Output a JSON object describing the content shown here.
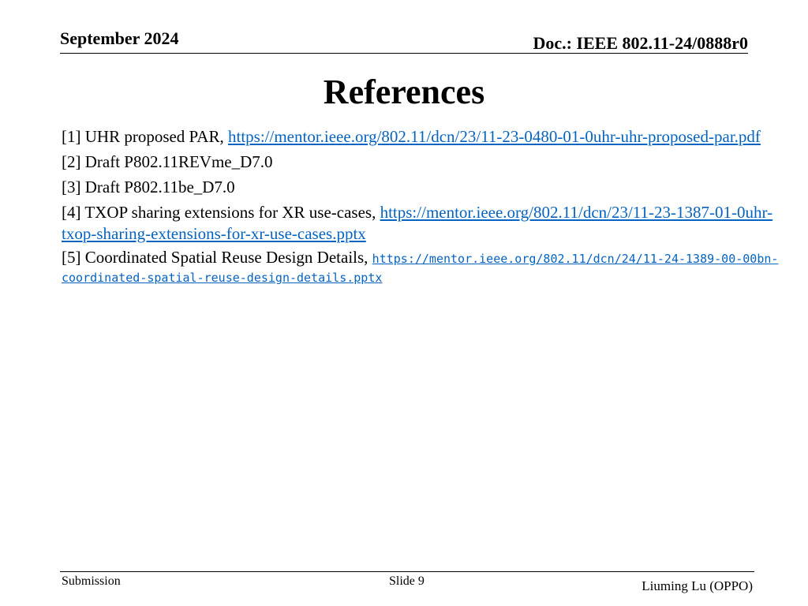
{
  "header": {
    "date": "September 2024",
    "doc_id": "Doc.: IEEE 802.11-24/0888r0"
  },
  "title": "References",
  "references": [
    {
      "text": "[1] UHR proposed PAR, ",
      "link": "https://mentor.ieee.org/802.11/dcn/23/11-23-0480-01-0uhr-uhr-proposed-par.pdf"
    },
    {
      "text": "[2] Draft P802.11REVme_D7.0"
    },
    {
      "text": "[3] Draft P802.11be_D7.0"
    },
    {
      "text": "[4] TXOP sharing extensions for XR use-cases, ",
      "link": "https://mentor.ieee.org/802.11/dcn/23/11-23-1387-01-0uhr-txop-sharing-extensions-for-xr-use-cases.pptx"
    },
    {
      "text": "[5] Coordinated Spatial Reuse Design Details, ",
      "link": "https://mentor.ieee.org/802.11/dcn/24/11-24-1389-00-00bn-coordinated-spatial-reuse-design-details.pptx"
    }
  ],
  "footer": {
    "submission": "Submission",
    "slide": "Slide 9",
    "author": "Liuming Lu (OPPO)"
  },
  "colors": {
    "link": "#0563c1",
    "text": "#000000",
    "background": "#ffffff"
  }
}
